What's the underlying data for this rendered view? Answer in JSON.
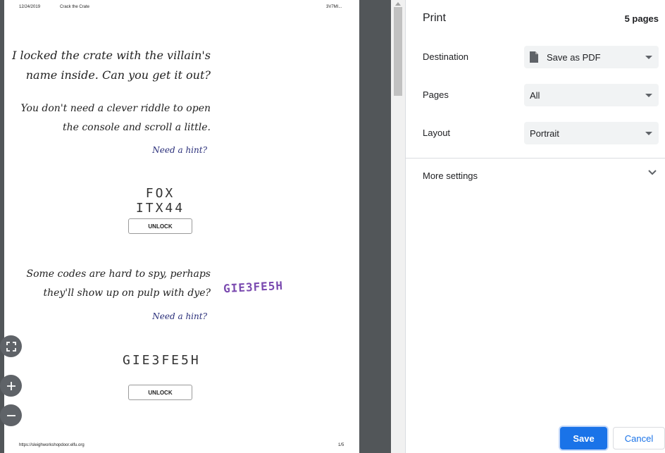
{
  "preview": {
    "header": {
      "date": "12/24/2019",
      "title": "Crack the Crate",
      "id": "3V7MI..."
    },
    "puzzle1": {
      "line1": "I locked the crate with the villain's",
      "line2": "name inside. Can you get it out?",
      "line3": "You don't need a clever riddle to open",
      "line4": "the console and scroll a little.",
      "hint": "Need a hint?",
      "code": "FOX ITX44",
      "button": "UNLOCK"
    },
    "puzzle2": {
      "line1": "Some codes are hard to spy, perhaps",
      "line2": "they'll show up on pulp with dye?",
      "hint": "Need a hint?",
      "dye_code": "GIE3FE5H",
      "code": "GIE3FE5H",
      "button": "UNLOCK"
    },
    "footer": {
      "url": "https://sleighworkshopdoor.elfu.org",
      "page": "1/5"
    },
    "zoom": {
      "fit_icon": "fit-to-page-icon",
      "zoom_in_icon": "plus-icon",
      "zoom_out_icon": "minus-icon"
    }
  },
  "panel": {
    "title": "Print",
    "page_count": "5 pages",
    "destination": {
      "label": "Destination",
      "value": "Save as PDF",
      "icon": "document-icon"
    },
    "pages": {
      "label": "Pages",
      "value": "All"
    },
    "layout": {
      "label": "Layout",
      "value": "Portrait"
    },
    "more_settings": "More settings",
    "save": "Save",
    "cancel": "Cancel"
  },
  "colors": {
    "accent": "#1a73e8",
    "preview_bg": "#525659",
    "dye": "#7b4bb0",
    "hint": "#2a2f7a"
  }
}
